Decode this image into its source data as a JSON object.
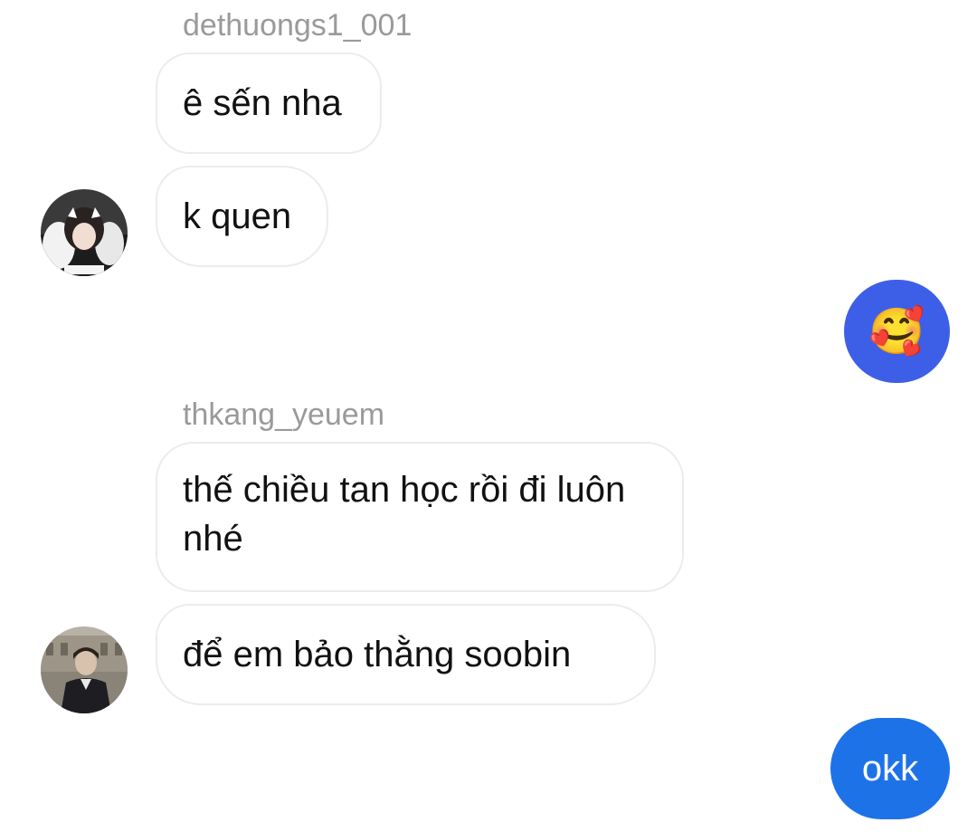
{
  "conversation": {
    "groups": [
      {
        "sender": "dethuongs1_001",
        "messages": [
          "ê sến nha",
          "k quen"
        ]
      },
      {
        "sender": "thkang_yeuem",
        "messages": [
          "thế chiều tan học rồi đi luôn nhé",
          "để em bảo thằng soobin"
        ]
      }
    ],
    "outgoing": [
      {
        "emoji": "🥰"
      },
      {
        "text": "okk"
      }
    ]
  },
  "colors": {
    "outgoing_emoji_bubble": "#3d5fe8",
    "outgoing_text_bubble": "#1d72e8",
    "incoming_border": "#ececec",
    "sender_name": "#9a9a9a"
  }
}
